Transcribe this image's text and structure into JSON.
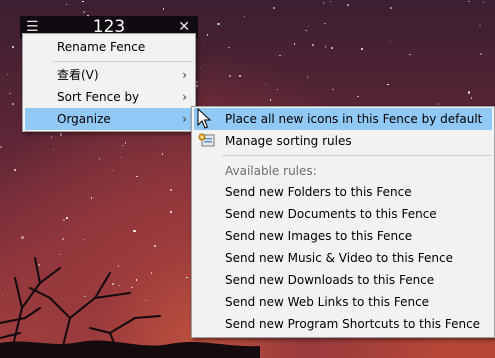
{
  "fence": {
    "title": "123",
    "menu_icon": "☰",
    "close_icon": "✕"
  },
  "context_menu": {
    "items": [
      {
        "label": "Rename Fence",
        "has_submenu": false
      },
      {
        "label": "查看(V)",
        "has_submenu": true
      },
      {
        "label": "Sort Fence by",
        "has_submenu": true
      },
      {
        "label": "Organize",
        "has_submenu": true,
        "highlighted": true
      }
    ],
    "submenu_arrow": "›"
  },
  "organize_submenu": {
    "place_all": "Place all new icons in this Fence by default",
    "manage_rules": "Manage sorting rules",
    "available_rules_heading": "Available rules:",
    "rules": [
      "Send new Folders to this Fence",
      "Send new Documents to this Fence",
      "Send new Images to this Fence",
      "Send new Music & Video to this Fence",
      "Send new Downloads to this Fence",
      "Send new Web Links to this Fence",
      "Send new Program Shortcuts to this Fence"
    ]
  },
  "colors": {
    "highlight": "#90c8f6",
    "menu_background": "#f2f2f2",
    "fence_bar": "#0c0a0e"
  },
  "icons": [
    "menu-icon",
    "close-icon",
    "chevron-right-icon",
    "sorting-rules-icon",
    "mouse-cursor-icon"
  ]
}
